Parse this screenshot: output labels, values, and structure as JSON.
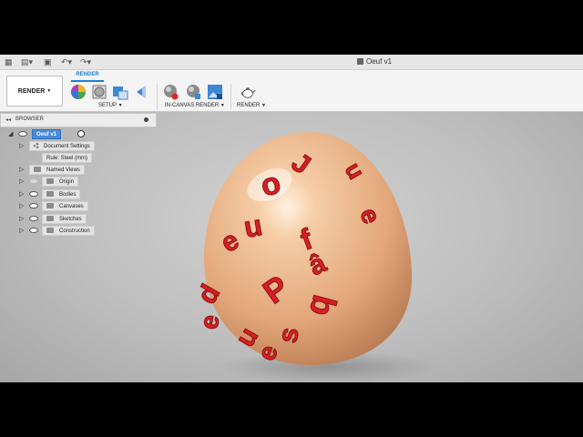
{
  "app": {
    "document_title": "Oeuf v1"
  },
  "ribbon": {
    "workspace_label": "RENDER",
    "active_tab": "RENDER",
    "groups": {
      "setup": "SETUP",
      "in_canvas_render": "IN-CANVAS RENDER",
      "render": "RENDER"
    }
  },
  "browser": {
    "title": "BROWSER",
    "root": "Oeuf v1",
    "items": [
      {
        "label": "Document Settings",
        "icon": "gear-icon"
      },
      {
        "label": "Rule: Steel (mm)",
        "icon": "none"
      },
      {
        "label": "Named Views",
        "icon": "folder-icon"
      },
      {
        "label": "Origin",
        "icon": "folder-icon"
      },
      {
        "label": "Bodies",
        "icon": "folder-icon"
      },
      {
        "label": "Canvases",
        "icon": "folder-icon"
      },
      {
        "label": "Sketches",
        "icon": "folder-icon"
      },
      {
        "label": "Construction",
        "icon": "folder-icon"
      }
    ]
  },
  "colors": {
    "accent": "#1f7fd4",
    "egg": "#e9b58d",
    "letters": "#d81f23",
    "tree_root": "#4a8ad8"
  }
}
